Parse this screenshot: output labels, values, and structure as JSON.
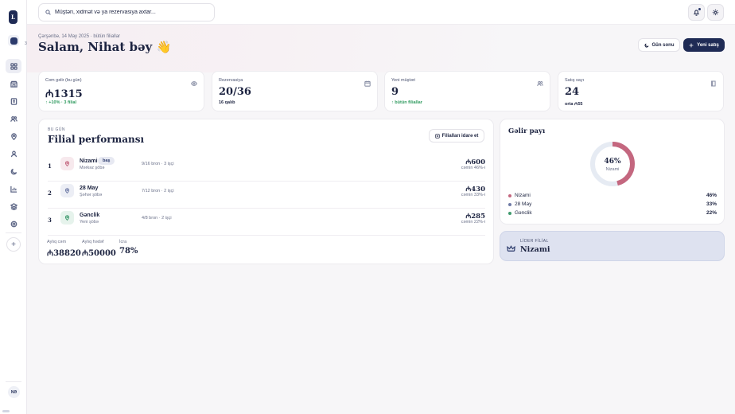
{
  "brand": {
    "logo": "L"
  },
  "workspace": {
    "count": "3"
  },
  "nav": [
    "grid-icon",
    "store-icon",
    "receipt-icon",
    "users-icon",
    "map-pin-icon",
    "user-icon",
    "moon-icon",
    "chart-icon",
    "layers-icon",
    "settings-icon"
  ],
  "user": {
    "initials": "NƏ"
  },
  "search": {
    "placeholder": "Müştəri, xidmət və ya rezervasiya axtar..."
  },
  "header": {
    "date_line": "Çərşənbə, 14 May 2025 · bütün filiallar",
    "greeting": "Salam, Nihat bəy 👋",
    "end_day_label": "Gün sonu",
    "new_sale_label": "Yeni satış"
  },
  "stats": [
    {
      "label": "Cəm gəlir (bu gün)",
      "value": "₼1315",
      "sub": "↑ +10% · 3 filial",
      "sub_style": "green",
      "icon": "eye-icon"
    },
    {
      "label": "Rezervasiya",
      "value": "20/36",
      "sub": "16 qalıb",
      "sub_style": "dark",
      "icon": "calendar-icon"
    },
    {
      "label": "Yeni müştəri",
      "value": "9",
      "sub": "↑ bütün filiallar",
      "sub_style": "green",
      "icon": "users-icon"
    },
    {
      "label": "Satış sayı",
      "value": "24",
      "sub": "orta ₼55",
      "sub_style": "dark",
      "icon": "book-icon"
    }
  ],
  "performance": {
    "eyebrow": "BU GÜN",
    "title": "Filial performansı",
    "manage_label": "Filialları idarə et",
    "branches": [
      {
        "rank": "1",
        "name": "Nizami",
        "subtitle": "Mərkəz şöbə",
        "badge": "baş",
        "meta": "9/16 bron · 3 işçi",
        "amount": "₼600",
        "share": "cəmin 46%-i",
        "color": "#c4677f",
        "bg": "#f7e9ed"
      },
      {
        "rank": "2",
        "name": "28 May",
        "subtitle": "Şəhər şöbə",
        "badge": "",
        "meta": "7/12 bron · 2 işçi",
        "amount": "₼430",
        "share": "cəmin 33%-i",
        "color": "#6f7ba6",
        "bg": "#eceef5"
      },
      {
        "rank": "3",
        "name": "Gənclik",
        "subtitle": "Yeni şöbə",
        "badge": "",
        "meta": "4/8 bron · 2 işçi",
        "amount": "₼285",
        "share": "cəmin 22%-i",
        "color": "#3f9a6e",
        "bg": "#e6f3ec"
      }
    ],
    "summary": [
      {
        "label": "Aylıq cəm",
        "value": "₼38820"
      },
      {
        "label": "Aylıq hədəf",
        "value": "₼50000"
      },
      {
        "label": "İcra",
        "value": "78%"
      }
    ]
  },
  "income_share": {
    "title": "Gəlir payı",
    "center_value": "46%",
    "center_label": "Nizami"
  },
  "chart_data": {
    "type": "pie",
    "title": "Gəlir payı",
    "categories": [
      "Nizami",
      "28 May",
      "Gənclik"
    ],
    "values": [
      46,
      33,
      22
    ],
    "colors": [
      "#c4677f",
      "#6f7ba6",
      "#3f9a6e"
    ],
    "highlighted": "Nizami",
    "legend": "bottom"
  },
  "leader": {
    "eyebrow": "LİDER FİLİAL",
    "name": "Nizami"
  }
}
